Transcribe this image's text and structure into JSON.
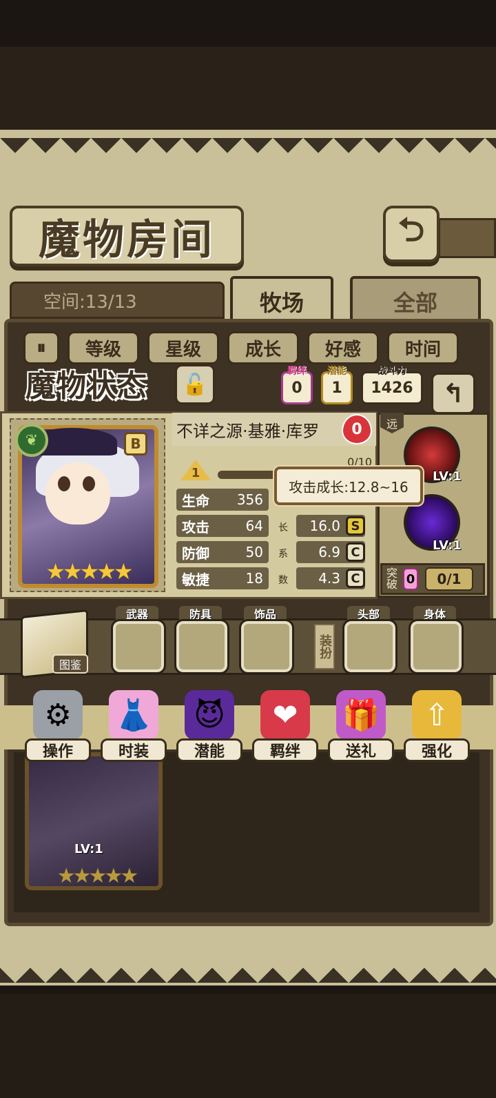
{
  "room": {
    "title": "魔物房间",
    "space_label": "空间:13/13"
  },
  "tabs": [
    {
      "label": "牧场"
    },
    {
      "label": "全部"
    }
  ],
  "sort_buttons": [
    "等级",
    "星级",
    "成长",
    "好感",
    "时间"
  ],
  "status": {
    "title": "魔物状态",
    "bond": {
      "label": "羁绊",
      "value": "0"
    },
    "potential": {
      "label": "潜能",
      "value": "1"
    },
    "power": {
      "label": "战斗力",
      "value": "1426"
    }
  },
  "monster": {
    "name": "不详之源·基雅·库罗",
    "affection": "0",
    "rank": "B",
    "stars": "★★★★★",
    "level": "1",
    "exp": "0/10",
    "stats": [
      {
        "label": "生命",
        "value": "356"
      },
      {
        "label": "攻击",
        "value": "64",
        "growth": "16.0",
        "grade": "S"
      },
      {
        "label": "防御",
        "value": "50",
        "growth": "6.9",
        "grade": "C"
      },
      {
        "label": "敏捷",
        "value": "18",
        "growth": "4.3",
        "grade": "C"
      }
    ],
    "growth_chars": [
      "长",
      "系",
      "数"
    ],
    "tooltip": "攻击成长:12.8~16"
  },
  "skills": {
    "range": "远",
    "items": [
      {
        "level": "LV:1"
      },
      {
        "level": "LV:1"
      }
    ],
    "breakthrough": {
      "label": "突破",
      "count": "0",
      "progress": "0/1"
    }
  },
  "equipment": {
    "codex": "图鉴",
    "slots": [
      "武器",
      "防具",
      "饰品",
      "头部",
      "身体"
    ],
    "outfit_label": "装扮"
  },
  "actions": [
    "操作",
    "时装",
    "潜能",
    "羁绊",
    "送礼",
    "强化"
  ],
  "list": {
    "card_level": "LV:1",
    "card_stars": "★★★★★"
  }
}
